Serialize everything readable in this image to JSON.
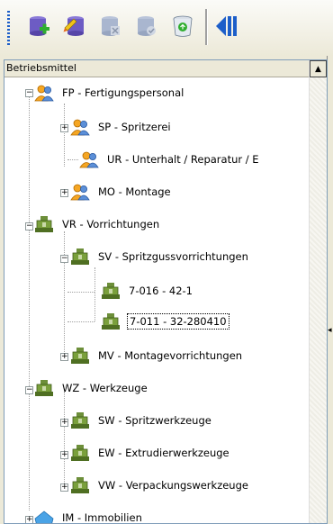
{
  "toolbar": {
    "buttons": [
      {
        "icon": "add-database-icon"
      },
      {
        "icon": "edit-database-icon"
      },
      {
        "icon": "delete-database-icon"
      },
      {
        "icon": "save-database-icon"
      },
      {
        "icon": "recycle-bin-icon"
      },
      {
        "icon": "collapse-panel-icon"
      }
    ]
  },
  "tree": {
    "header": "Betriebsmittel",
    "nodes": [
      {
        "label": "FP - Fertigungspersonal",
        "icon": "people-icon"
      },
      {
        "label": "SP - Spritzerei",
        "icon": "people-icon"
      },
      {
        "label": "UR - Unterhalt / Reparatur / E",
        "icon": "people-icon"
      },
      {
        "label": "MO - Montage",
        "icon": "people-icon"
      },
      {
        "label": "VR - Vorrichtungen",
        "icon": "tool-icon"
      },
      {
        "label": "SV - Spritzgussvorrichtungen",
        "icon": "tool-icon"
      },
      {
        "label": "7-016 - 42-1",
        "icon": "tool-icon"
      },
      {
        "label": "7-011 - 32-280410",
        "icon": "tool-icon"
      },
      {
        "label": "MV - Montagevorrichtungen",
        "icon": "tool-icon"
      },
      {
        "label": "WZ - Werkzeuge",
        "icon": "tool-icon"
      },
      {
        "label": "SW - Spritzwerkzeuge",
        "icon": "tool-icon"
      },
      {
        "label": "EW - Extrudierwerkzeuge",
        "icon": "tool-icon"
      },
      {
        "label": "VW - Verpackungswerkzeuge",
        "icon": "tool-icon"
      },
      {
        "label": "IM - Immobilien",
        "icon": "building-icon"
      }
    ]
  },
  "colors": {
    "accent": "#1c5ec9",
    "selection_border": "#000000"
  }
}
